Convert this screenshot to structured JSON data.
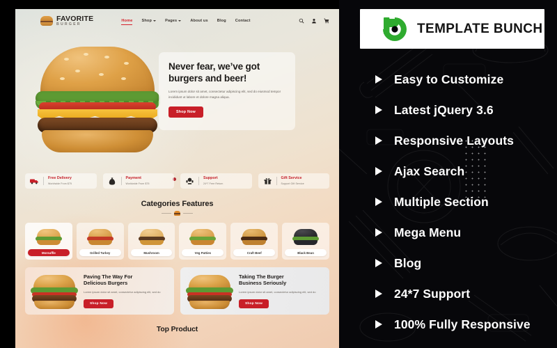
{
  "site": {
    "brand": {
      "title": "FAVORITE",
      "subtitle": "BURGER",
      "icon": "burger-logo-icon"
    },
    "nav": [
      {
        "label": "Home",
        "active": true,
        "caret": false
      },
      {
        "label": "Shop",
        "active": false,
        "caret": true
      },
      {
        "label": "Pages",
        "active": false,
        "caret": true
      },
      {
        "label": "About us",
        "active": false,
        "caret": false
      },
      {
        "label": "Blog",
        "active": false,
        "caret": false
      },
      {
        "label": "Contact",
        "active": false,
        "caret": false
      }
    ],
    "tools": [
      {
        "name": "search-icon"
      },
      {
        "name": "user-account-icon"
      },
      {
        "name": "shopping-cart-icon"
      }
    ],
    "hero": {
      "title_line1": "Never fear, we’ve got",
      "title_line2": "burgers and beer!",
      "description": "Lorem ipsum dolor sit amet, consectetur adipiscing elit, sed do eiusmod tempor incididunt ut labore et dolore magna aliqua.",
      "cta": "Shop Now",
      "image": "hero-burger-image",
      "slides": 1
    },
    "features": [
      {
        "title": "Free Delivery",
        "subtitle": "Worldwide From $75",
        "icon": "delivery-truck-icon"
      },
      {
        "title": "Payment",
        "subtitle": "Worldwide From $75",
        "icon": "money-bag-icon"
      },
      {
        "title": "Support",
        "subtitle": "24*7 Free Return",
        "icon": "support-headset-icon"
      },
      {
        "title": "Gift Service",
        "subtitle": "Support Gift Service",
        "icon": "gift-box-icon"
      }
    ],
    "categories_section": {
      "heading": "Categories Features",
      "items": [
        {
          "label": "Morsuffle",
          "selected": true
        },
        {
          "label": "Grilled Turkey",
          "selected": false
        },
        {
          "label": "Mushroom",
          "selected": false
        },
        {
          "label": "Veg Patties",
          "selected": false
        },
        {
          "label": "Craft Beef",
          "selected": false
        },
        {
          "label": "Black Bean",
          "selected": false
        }
      ]
    },
    "promos": [
      {
        "title_line1": "Paving The Way For",
        "title_line2": "Delicious Burgers",
        "description": "Lorem ipsum dolor sit amet, consectetur adipiscing elit, sed do",
        "cta": "Shop Now"
      },
      {
        "title_line1": "Taking The Burger",
        "title_line2": "Business Seriously",
        "description": "Lorem ipsum dolor sit amet, consectetur adipiscing elit, sed do",
        "cta": "Shop Now"
      }
    ],
    "bottom_heading": "Top Product"
  },
  "panel": {
    "logo": {
      "name": "TEMPLATE BUNCH",
      "mark": "template-bunch-logo-icon",
      "mark_color": "#2fab2f"
    },
    "features": [
      "Easy to Customize",
      "Latest jQuery 3.6",
      "Responsive Layouts",
      "Ajax Search",
      "Multiple Section",
      "Mega Menu",
      "Blog",
      "24*7 Support",
      "100% Fully Responsive"
    ]
  },
  "colors": {
    "accent_red": "#c81f28",
    "panel_bg": "#07070a",
    "brand_green": "#2fab2f"
  }
}
